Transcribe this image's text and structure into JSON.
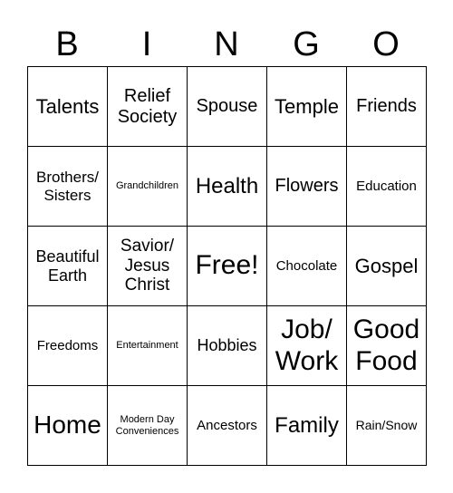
{
  "header": [
    "B",
    "I",
    "N",
    "G",
    "O"
  ],
  "cells": [
    "Talents",
    "Relief\nSociety",
    "Spouse",
    "Temple",
    "Friends",
    "Brothers/\nSisters",
    "Grandchildren",
    "Health",
    "Flowers",
    "Education",
    "Beautiful\nEarth",
    "Savior/\nJesus\nChrist",
    "Free!",
    "Chocolate",
    "Gospel",
    "Freedoms",
    "Entertainment",
    "Hobbies",
    "Job/\nWork",
    "Good\nFood",
    "Home",
    "Modern Day\nConveniences",
    "Ancestors",
    "Family",
    "Rain/Snow"
  ]
}
